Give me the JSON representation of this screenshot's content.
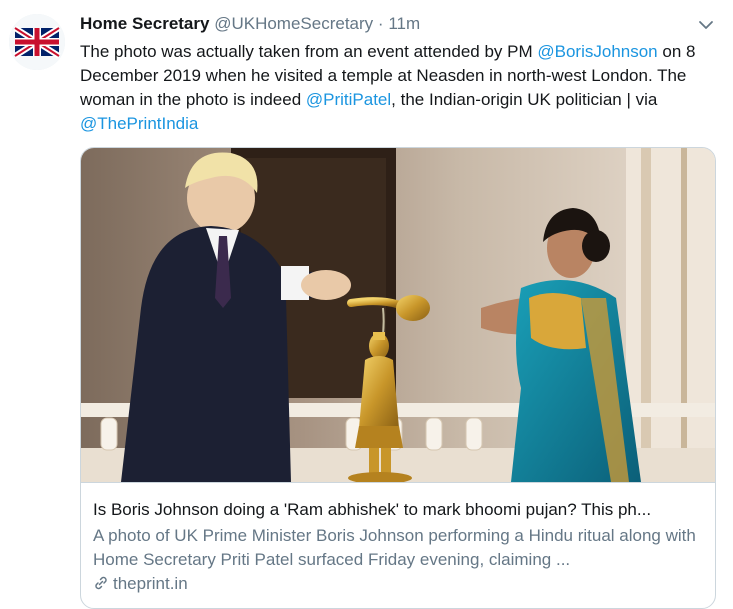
{
  "tweet": {
    "author_name": "Home Secretary",
    "author_handle": "@UKHomeSecretary",
    "separator": "·",
    "time": "11m",
    "text": {
      "part1": "The photo was actually taken from an event attended by PM ",
      "mention1": "@BorisJohnson",
      "part2": " on 8 December 2019 when he visited a temple at Neasden in north-west London. The woman in the photo is indeed ",
      "mention2": "@PritiPatel",
      "part3": ", the Indian-origin UK politician | via ",
      "mention3": "@ThePrintIndia"
    }
  },
  "card": {
    "title": "Is Boris Johnson doing a 'Ram abhishek' to mark bhoomi pujan? This ph...",
    "description": "A photo of UK Prime Minister Boris Johnson performing a Hindu ritual along with Home Secretary Priti Patel surfaced Friday evening, claiming ...",
    "domain": "theprint.in"
  },
  "icons": {
    "avatar": "union-jack-icon",
    "menu": "chevron-down-icon"
  },
  "colors": {
    "link": "#1b95e0",
    "secondary_text": "#657786",
    "border": "#ccd6dd"
  }
}
